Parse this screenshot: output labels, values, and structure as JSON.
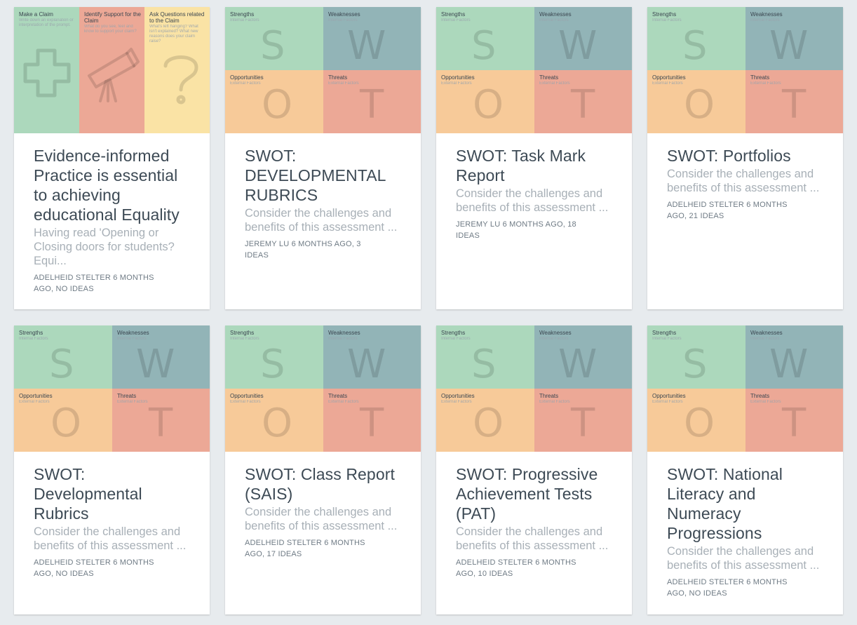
{
  "swot_quadrants": {
    "strengths": {
      "label": "Strengths",
      "sub": "Internal Factors",
      "letter": "S"
    },
    "weaknesses": {
      "label": "Weaknesses",
      "sub": "Internal Factors",
      "letter": "W"
    },
    "opportunities": {
      "label": "Opportunities",
      "sub": "External Factors",
      "letter": "O"
    },
    "threats": {
      "label": "Threats",
      "sub": "External Factors",
      "letter": "T"
    }
  },
  "claim_columns": [
    {
      "label": "Make a Claim",
      "sub": "Write down an explanation or interpretation of the prompt."
    },
    {
      "label": "Identify Support for the Claim",
      "sub": "What do you see, feel and know to support your claim?"
    },
    {
      "label": "Ask Questions related to the Claim",
      "sub": "What's left hanging? What isn't explained? What new reasons does your claim raise?"
    }
  ],
  "colors": {
    "green": "#acd8bc",
    "teal": "#92b4b7",
    "orange": "#f7ca99",
    "red": "#eca896",
    "yellow": "#fae3a5"
  },
  "cards": [
    {
      "title": "Evidence-informed Practice is essential to achieving educational Equality",
      "desc": "Having read 'Opening or Closing doors for students? Equi...",
      "meta": "ADELHEID STELTER 6 MONTHS AGO, NO IDEAS"
    },
    {
      "title": "SWOT: DEVELOPMENTAL RUBRICS",
      "desc": "Consider the challenges and benefits of this assessment ...",
      "meta": "JEREMY LU 6 MONTHS AGO, 3 IDEAS"
    },
    {
      "title": "SWOT: Task Mark Report",
      "desc": "Consider the challenges and benefits of this assessment ...",
      "meta": "JEREMY LU 6 MONTHS AGO, 18 IDEAS"
    },
    {
      "title": "SWOT: Portfolios",
      "desc": "Consider the challenges and benefits of this assessment ...",
      "meta": "ADELHEID STELTER 6 MONTHS AGO, 21 IDEAS"
    },
    {
      "title": "SWOT: Developmental Rubrics",
      "desc": "Consider the challenges and benefits of this assessment ...",
      "meta": "ADELHEID STELTER 6 MONTHS AGO, NO IDEAS"
    },
    {
      "title": "SWOT: Class Report (SAIS)",
      "desc": "Consider the challenges and benefits of this assessment ...",
      "meta": "ADELHEID STELTER 6 MONTHS AGO, 17 IDEAS"
    },
    {
      "title": "SWOT: Progressive Achievement Tests (PAT)",
      "desc": "Consider the challenges and benefits of this assessment ...",
      "meta": "ADELHEID STELTER 6 MONTHS AGO, 10 IDEAS"
    },
    {
      "title": "SWOT: National Literacy and Numeracy Progressions",
      "desc": "Consider the challenges and benefits of this assessment ...",
      "meta": "ADELHEID STELTER 6 MONTHS AGO, NO IDEAS"
    }
  ]
}
